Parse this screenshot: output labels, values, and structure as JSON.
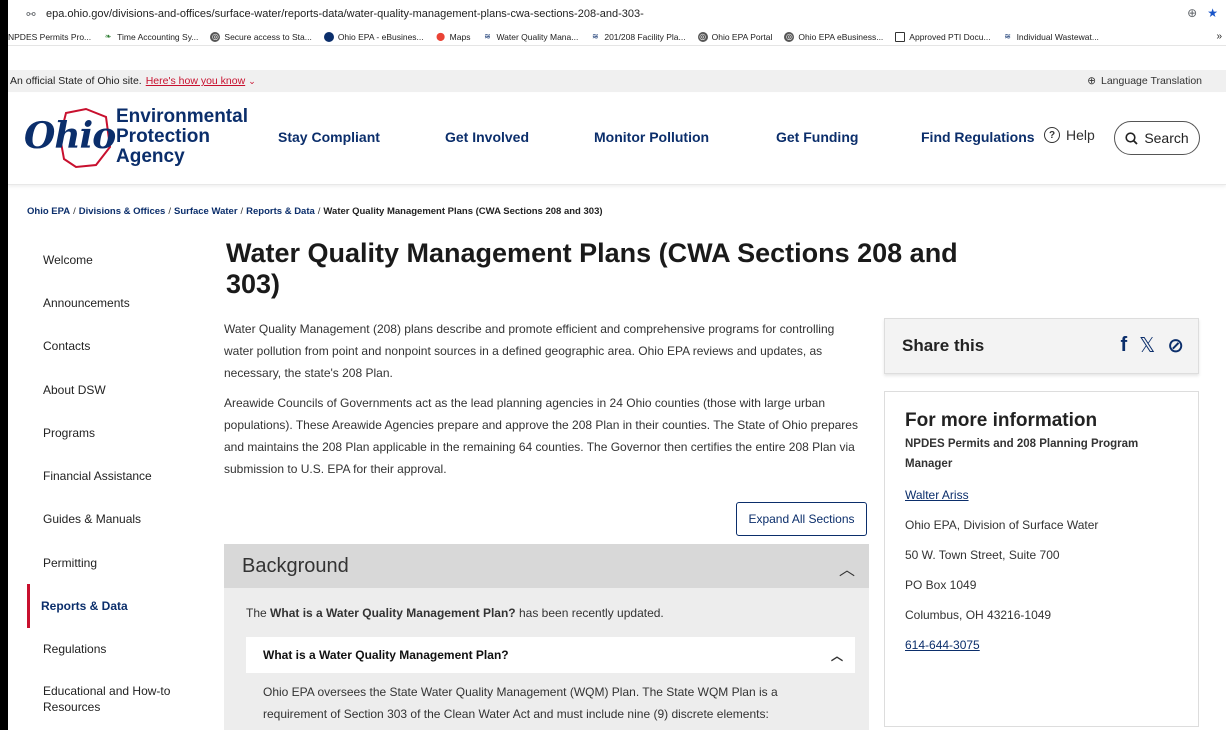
{
  "browser": {
    "url": "epa.ohio.gov/divisions-and-offices/surface-water/reports-data/water-quality-management-plans-cwa-sections-208-and-303-",
    "bookmarks": [
      "NPDES Permits Pro...",
      "Time Accounting Sy...",
      "Secure access to Sta...",
      "Ohio EPA - eBusines...",
      "Maps",
      "Water Quality Mana...",
      "201/208 Facility Pla...",
      "Ohio EPA Portal",
      "Ohio EPA eBusiness...",
      "Approved PTI Docu...",
      "Individual Wastewat..."
    ],
    "more": "»"
  },
  "banner": {
    "official": "An official State of Ohio site.",
    "how": "Here's how you know",
    "language": "Language Translation"
  },
  "header": {
    "logo_script": "Ohio",
    "logo_lines": [
      "Environmental",
      "Protection",
      "Agency"
    ],
    "nav": [
      "Stay Compliant",
      "Get Involved",
      "Monitor Pollution",
      "Get Funding",
      "Find Regulations"
    ],
    "help": "Help",
    "search": "Search"
  },
  "breadcrumb": {
    "items": [
      "Ohio EPA",
      "Divisions & Offices",
      "Surface Water",
      "Reports & Data"
    ],
    "current": "Water Quality Management Plans (CWA Sections 208 and 303)",
    "sep": "/"
  },
  "sidebar": {
    "items": [
      "Welcome",
      "Announcements",
      "Contacts",
      "About DSW",
      "Programs",
      "Financial Assistance",
      "Guides & Manuals",
      "Permitting",
      "Reports & Data",
      "Regulations",
      "Educational and How-to Resources"
    ]
  },
  "main": {
    "title": "Water Quality Management Plans (CWA Sections 208 and 303)",
    "paragraphs": [
      "Water Quality Management (208) plans describe and promote efficient and comprehensive programs for controlling water pollution from point and nonpoint sources in a defined geographic area. Ohio EPA reviews and updates, as necessary, the state's 208 Plan.",
      "Areawide Councils of Governments act as the lead planning agencies in 24 Ohio counties (those with large urban populations). These Areawide Agencies prepare and approve the 208 Plan in their counties. The State of Ohio prepares and maintains the 208 Plan applicable in the remaining 64 counties. The Governor then certifies the entire 208 Plan via submission to U.S. EPA for their approval."
    ],
    "expand_all": "Expand All Sections",
    "accordion": {
      "title": "Background",
      "note_prefix": "The",
      "note_bold": "What is a Water Quality Management Plan?",
      "note_suffix": "has been recently updated.",
      "sub_title": "What is a Water Quality Management Plan?",
      "sub_body": "Ohio EPA oversees the State Water Quality Management (WQM) Plan. The State WQM Plan is a requirement of Section 303 of the Clean Water Act and must include nine (9) discrete elements:"
    }
  },
  "aside": {
    "share_title": "Share this",
    "info_title": "For more information",
    "info_subtitle": "NPDES Permits and 208 Planning Program Manager",
    "contact_name": "Walter Ariss",
    "office": "Ohio EPA, Division of Surface Water",
    "street": "50 W. Town Street, Suite 700",
    "po_box": "PO Box 1049",
    "city": "Columbus, OH 43216-1049",
    "phone": "614-644-3075"
  },
  "colors": {
    "brand_navy": "#0b2e6b",
    "accent_red": "#c8102e"
  }
}
